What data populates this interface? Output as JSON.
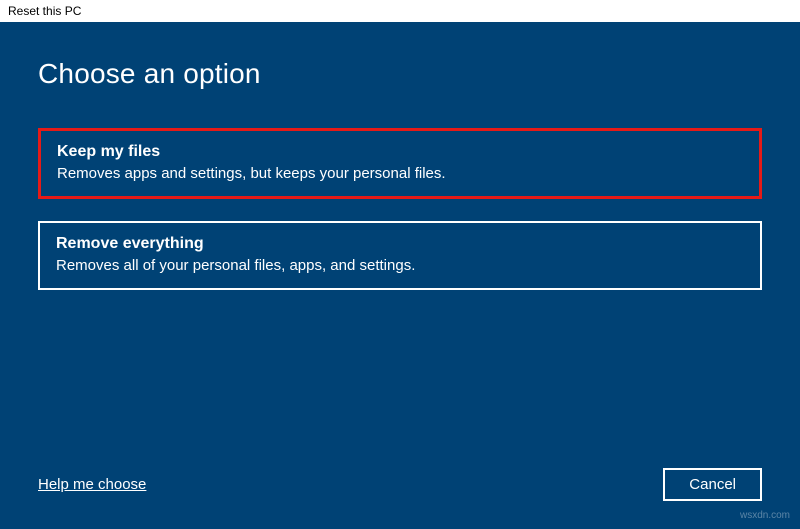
{
  "window": {
    "title": "Reset this PC"
  },
  "page": {
    "heading": "Choose an option"
  },
  "options": {
    "keep": {
      "title": "Keep my files",
      "description": "Removes apps and settings, but keeps your personal files."
    },
    "remove": {
      "title": "Remove everything",
      "description": "Removes all of your personal files, apps, and settings."
    }
  },
  "footer": {
    "help_label": "Help me choose",
    "cancel_label": "Cancel"
  },
  "watermark": "wsxdn.com"
}
